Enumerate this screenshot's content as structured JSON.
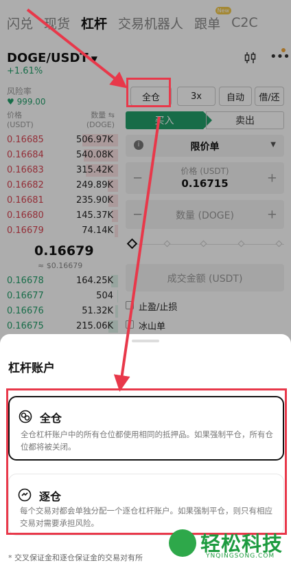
{
  "nav": {
    "tabs": [
      {
        "label": "闪兑"
      },
      {
        "label": "现货"
      },
      {
        "label": "杠杆"
      },
      {
        "label": "交易机器人"
      },
      {
        "label": "跟单",
        "badge": "New"
      },
      {
        "label": "C2C"
      }
    ],
    "active_index": 2
  },
  "pair": {
    "symbol": "DOGE/USDT",
    "change": "+1.61%"
  },
  "risk": {
    "label": "风险率",
    "value": "999.00"
  },
  "mode_buttons": {
    "margin_mode": "全仓",
    "leverage": "3x",
    "borrow": "自动",
    "repay": "借/还"
  },
  "trade_tabs": {
    "buy": "买入",
    "sell": "卖出"
  },
  "orderbook": {
    "price_header": "价格",
    "price_unit": "(USDT)",
    "qty_header": "数量 ⇆",
    "qty_unit": "(DOGE)",
    "asks": [
      {
        "price": "0.16685",
        "qty": "506.97K",
        "depth": 0.52
      },
      {
        "price": "0.16684",
        "qty": "540.08K",
        "depth": 0.5
      },
      {
        "price": "0.16683",
        "qty": "315.42K",
        "depth": 0.47
      },
      {
        "price": "0.16682",
        "qty": "249.89K",
        "depth": 0.15
      },
      {
        "price": "0.16681",
        "qty": "235.90K",
        "depth": 0.14
      },
      {
        "price": "0.16680",
        "qty": "145.37K",
        "depth": 0.09
      },
      {
        "price": "0.16679",
        "qty": "74.14K",
        "depth": 0.05
      }
    ],
    "last_price": "0.16679",
    "last_price_usd": "≈ $0.16679",
    "bids": [
      {
        "price": "0.16678",
        "qty": "164.25K",
        "depth": 0.1
      },
      {
        "price": "0.16677",
        "qty": "504",
        "depth": 0.01
      },
      {
        "price": "0.16676",
        "qty": "51.32K",
        "depth": 0.04
      },
      {
        "price": "0.16675",
        "qty": "215.06K",
        "depth": 0.14
      }
    ]
  },
  "order_form": {
    "order_type": "限价单",
    "price_label": "价格 (USDT)",
    "price_value": "0.16715",
    "qty_placeholder": "数量 (DOGE)",
    "amount_placeholder": "成交金额 (USDT)",
    "tp_sl": "止盈/止损",
    "iceberg": "冰山单",
    "minus": "−",
    "plus": "+"
  },
  "sheet": {
    "title": "杠杆账户",
    "options": [
      {
        "title": "全仓",
        "desc": "全仓杠杆账户中的所有仓位都使用相同的抵押品。如果强制平仓，所有仓位都将被关闭。",
        "selected": true
      },
      {
        "title": "逐仓",
        "desc": "每个交易对都会单独分配一个逐仓杠杆账户。如果强制平仓，则只有相应交易对需要承担风险。",
        "selected": false
      }
    ],
    "footnote": "* 交叉保证金和逐仓保证金的交易对有所"
  },
  "watermark": {
    "text": "轻松科技",
    "sub": "YNQINGSONG.COM"
  },
  "colors": {
    "green": "#22a06b",
    "red": "#d94452",
    "annotation": "#e8384a"
  }
}
